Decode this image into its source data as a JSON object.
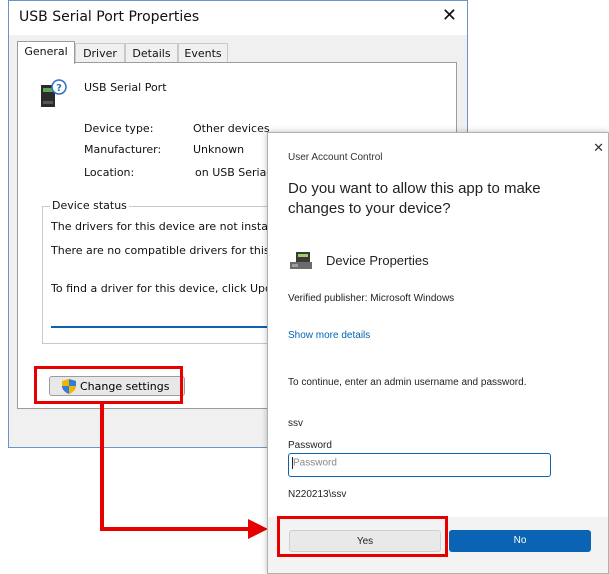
{
  "properties_window": {
    "title": "USB Serial Port Properties",
    "close_glyph": "✕",
    "tabs": [
      "General",
      "Driver",
      "Details",
      "Events"
    ],
    "device_name": "USB Serial Port",
    "device_type_label": "Device type:",
    "device_type_value": "Other devices",
    "manufacturer_label": "Manufacturer:",
    "manufacturer_value": "Unknown",
    "location_label": "Location:",
    "location_value": "on USB Seria",
    "device_status_label": "Device status",
    "status_lines": [
      "The drivers for this device are not install",
      "There are no compatible drivers for this",
      "To find a driver for this device, click Upda"
    ],
    "change_settings_label": "Change settings"
  },
  "uac_dialog": {
    "header": "User Account Control",
    "close_glyph": "✕",
    "question": "Do you want to allow this app to make changes to your device?",
    "program_name": "Device Properties",
    "publisher": "Verified publisher: Microsoft Windows",
    "more_details": "Show more details",
    "instruction": "To continue, enter an admin username and password.",
    "username": "ssv",
    "password_label": "Password",
    "password_placeholder": "Password",
    "domain_user": "N220213\\ssv",
    "yes_label": "Yes",
    "no_label": "No"
  },
  "colors": {
    "highlight": "#e60000",
    "accent_blue": "#0b63b4",
    "link_blue": "#0065b3"
  }
}
